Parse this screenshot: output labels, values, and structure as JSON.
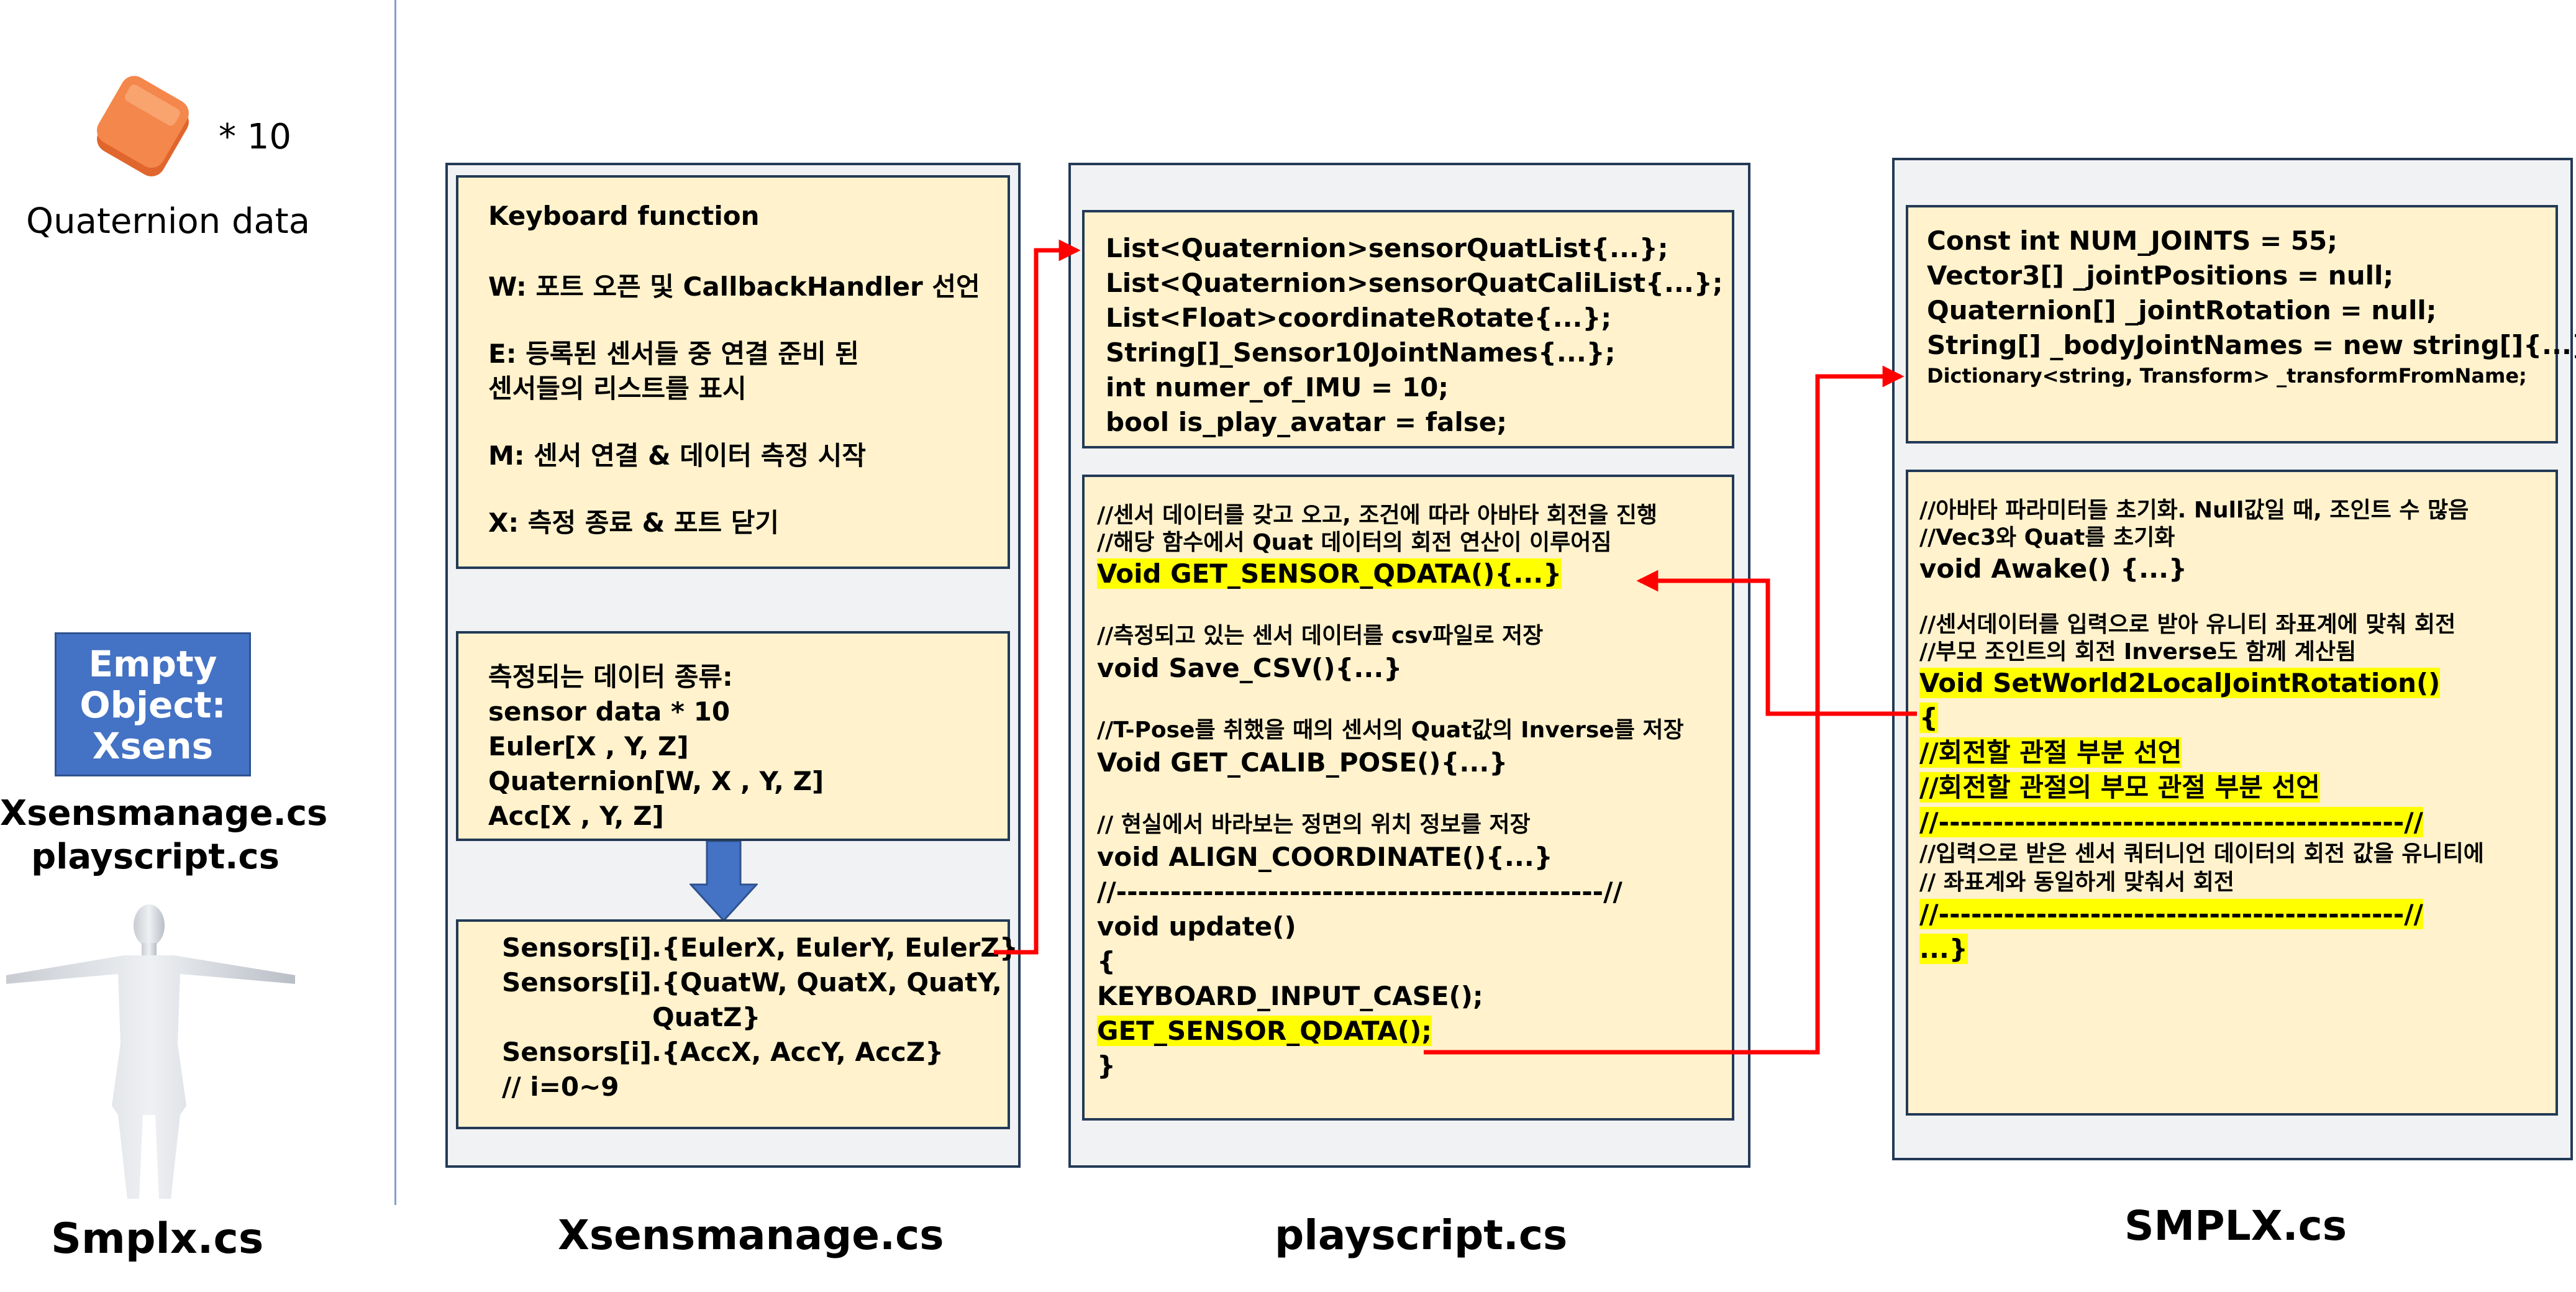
{
  "left": {
    "sensor_count": "* 10",
    "quaternion_label": "Quaternion data",
    "empty_object": [
      "Empty",
      "Object:",
      "Xsens"
    ],
    "scripts": [
      "Xsensmanage.cs",
      "playscript.cs"
    ],
    "bottom_label": "Smplx.cs"
  },
  "titles": {
    "xsens": "Xsensmanage.cs",
    "playscript": "playscript.cs",
    "smplx": "SMPLX.cs"
  },
  "keyboard": {
    "heading": "Keyboard function",
    "w": "W: 포트 오픈 및 CallbackHandler 선언",
    "e1": "E: 등록된 센서들 중 연결 준비 된",
    "e2": "센서들의 리스트를 표시",
    "m": "M: 센서 연결 & 데이터 측정 시작",
    "x": "X: 측정 종료 & 포트 닫기"
  },
  "data_types": [
    "측정되는 데이터 종류:",
    "sensor data * 10",
    "Euler[X , Y, Z]",
    "Quaternion[W, X , Y, Z]",
    "Acc[X , Y, Z]"
  ],
  "sensors": [
    "Sensors[i].{EulerX, EulerY, EulerZ}",
    "Sensors[i].{QuatW, QuatX, QuatY,",
    "QuatZ}",
    "Sensors[i].{AccX, AccY, AccZ}",
    "// i=0~9"
  ],
  "play_fields": [
    "List<Quaternion>sensorQuatList{...};",
    "List<Quaternion>sensorQuatCaliList{...};",
    "List<Float>coordinateRotate{...};",
    "String[]_Sensor10JointNames{...};",
    "int numer_of_IMU = 10;",
    "bool is_play_avatar = false;"
  ],
  "play_methods": {
    "c1": "//센서 데이터를 갖고 오고, 조건에 따라 아바타 회전을 진행",
    "c2": "//해당 함수에서 Quat 데이터의 회전 연산이 이루어짐",
    "m1": "Void GET_SENSOR_QDATA(){...}",
    "c3": "//측정되고 있는 센서 데이터를 csv파일로 저장",
    "m2": "void Save_CSV(){...}",
    "c4": "//T-Pose를 취했을 때의 센서의 Quat값의 Inverse를 저장",
    "m3": "Void GET_CALIB_POSE(){...}",
    "c5": "// 현실에서 바라보는 정면의 위치 정보를 저장",
    "m4": "void ALIGN_COORDINATE(){...}",
    "sep": "//---------------------------------------------//",
    "m5": "void update()",
    "b1": "{",
    "m6": "KEYBOARD_INPUT_CASE();",
    "m7": "GET_SENSOR_QDATA();",
    "b2": "}"
  },
  "smplx_fields": [
    "Const int NUM_JOINTS = 55;",
    "Vector3[] _jointPositions = null;",
    "Quaternion[] _jointRotation = null;",
    "String[] _bodyJointNames = new string[]{...};",
    "Dictionary<string, Transform> _transformFromName;"
  ],
  "smplx_methods": {
    "c1": "//아바타 파라미터들 초기화. Null값일 때, 조인트 수 많음",
    "c2": "//Vec3와 Quat를 초기화",
    "m1": "void Awake() {...}",
    "c3": "//센서데이터를 입력으로 받아 유니티 좌표계에 맞춰 회전",
    "c4": "//부모 조인트의 회전 Inverse도 함께 계산됨",
    "m2": "Void SetWorld2LocalJointRotation()",
    "b1": "{",
    "h1": "//회전할 관절 부분 선언",
    "h2": "//회전할 관절의 부모 관절 부분 선언",
    "sep1": "//-------------------------------------------//",
    "c5": "//입력으로 받은 센서 쿼터니언 데이터의 회전 값을 유니티에",
    "c6": "// 좌표계와 동일하게 맞춰서 회전",
    "sep2": "//-------------------------------------------//",
    "end": "...}"
  },
  "colors": {
    "box_fill": "#fff2cc",
    "panel_fill": "#f1f2f4",
    "border": "#233a57",
    "highlight": "#ffff00",
    "arrow": "#ff0000",
    "object_box": "#4472c4",
    "sensor": "#f4874b"
  }
}
